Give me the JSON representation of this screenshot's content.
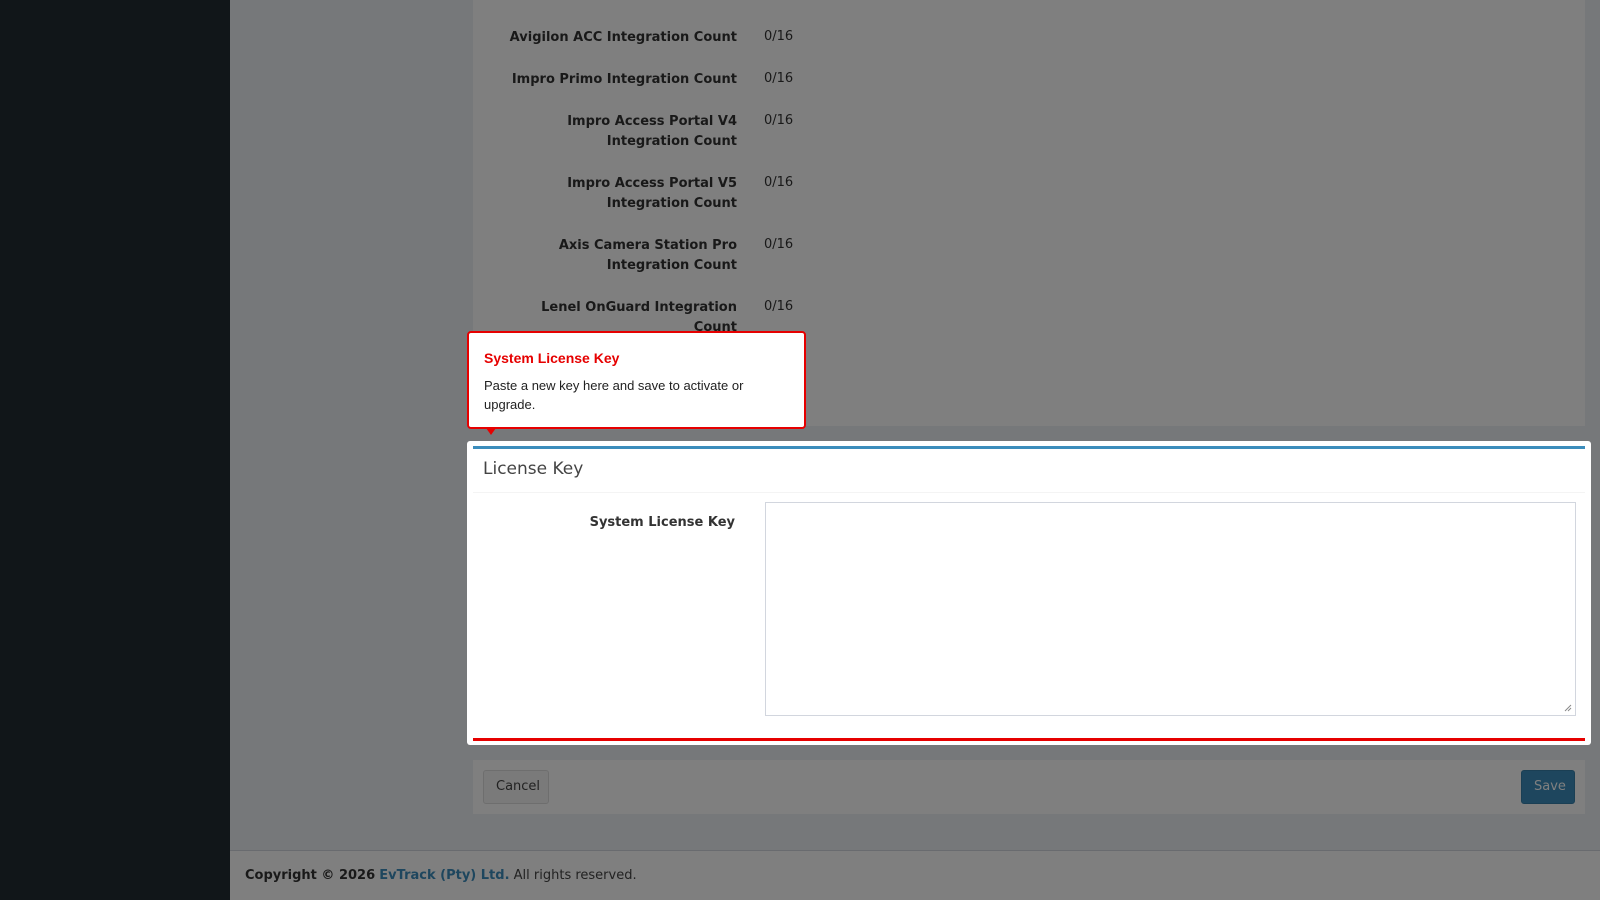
{
  "integration_counts": [
    {
      "label": "Avigilon ACC Integration Count",
      "value": "0/16"
    },
    {
      "label": "Impro Primo Integration Count",
      "value": "0/16"
    },
    {
      "label": "Impro Access Portal V4 Integration Count",
      "value": "0/16"
    },
    {
      "label": "Impro Access Portal V5 Integration Count",
      "value": "0/16"
    },
    {
      "label": "Axis Camera Station Pro Integration Count",
      "value": "0/16"
    },
    {
      "label": "Lenel OnGuard Integration Count",
      "value": "0/16"
    }
  ],
  "popover": {
    "title": "System License Key",
    "body": "Paste a new key here and save to activate or upgrade."
  },
  "license_box": {
    "title": "License Key",
    "field_label": "System License Key",
    "field_value": ""
  },
  "form_buttons": {
    "cancel_label": "Cancel",
    "save_label": "Save"
  },
  "footer": {
    "copyright_prefix": "Copyright © 2026",
    "company": "EvTrack (Pty) Ltd.",
    "suffix": "All rights reserved."
  },
  "colors": {
    "sidebar_bg": "#222d32",
    "accent_blue": "#3c8dbc",
    "tour_red": "#e60000"
  }
}
